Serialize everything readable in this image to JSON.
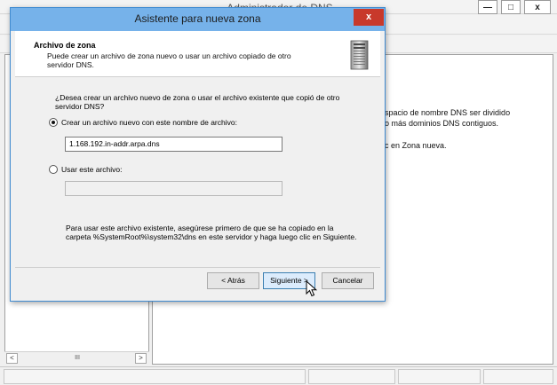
{
  "background_window": {
    "title": "Administrador de DNS",
    "minimize_label": "—",
    "maximize_label": "□",
    "close_label": "x",
    "right_pane_lines": [
      "spacio de nombre DNS ser dividido",
      "o más dominios DNS contiguos.",
      "c en Zona nueva."
    ],
    "scroll_thumb_label": "III",
    "scroll_left_label": "<",
    "scroll_right_label": ">"
  },
  "dialog": {
    "title": "Asistente para nueva zona",
    "close_label": "x",
    "header": {
      "title": "Archivo de zona",
      "description": "Puede crear un archivo de zona nuevo o usar un archivo copiado de otro servidor DNS.",
      "icon": "server-icon"
    },
    "question": "¿Desea crear un archivo nuevo de zona o usar el archivo existente que copió de otro servidor DNS?",
    "option_new": {
      "label": "Crear un archivo nuevo con este nombre de archivo:",
      "selected": true,
      "value": "1.168.192.in-addr.arpa.dns"
    },
    "option_existing": {
      "label": "Usar este archivo:",
      "selected": false,
      "value": ""
    },
    "note": "Para usar este archivo existente, asegúrese primero de que se ha copiado en la carpeta %SystemRoot%\\system32\\dns en este servidor y haga luego clic en Siguiente.",
    "buttons": {
      "back": "< Atrás",
      "next": "Siguiente >",
      "cancel": "Cancelar"
    }
  },
  "colors": {
    "dialog_title_bar": "#76b2ea",
    "dialog_border": "#3f8ad0",
    "close_button": "#c8392b",
    "default_button": "#dcecfc"
  }
}
